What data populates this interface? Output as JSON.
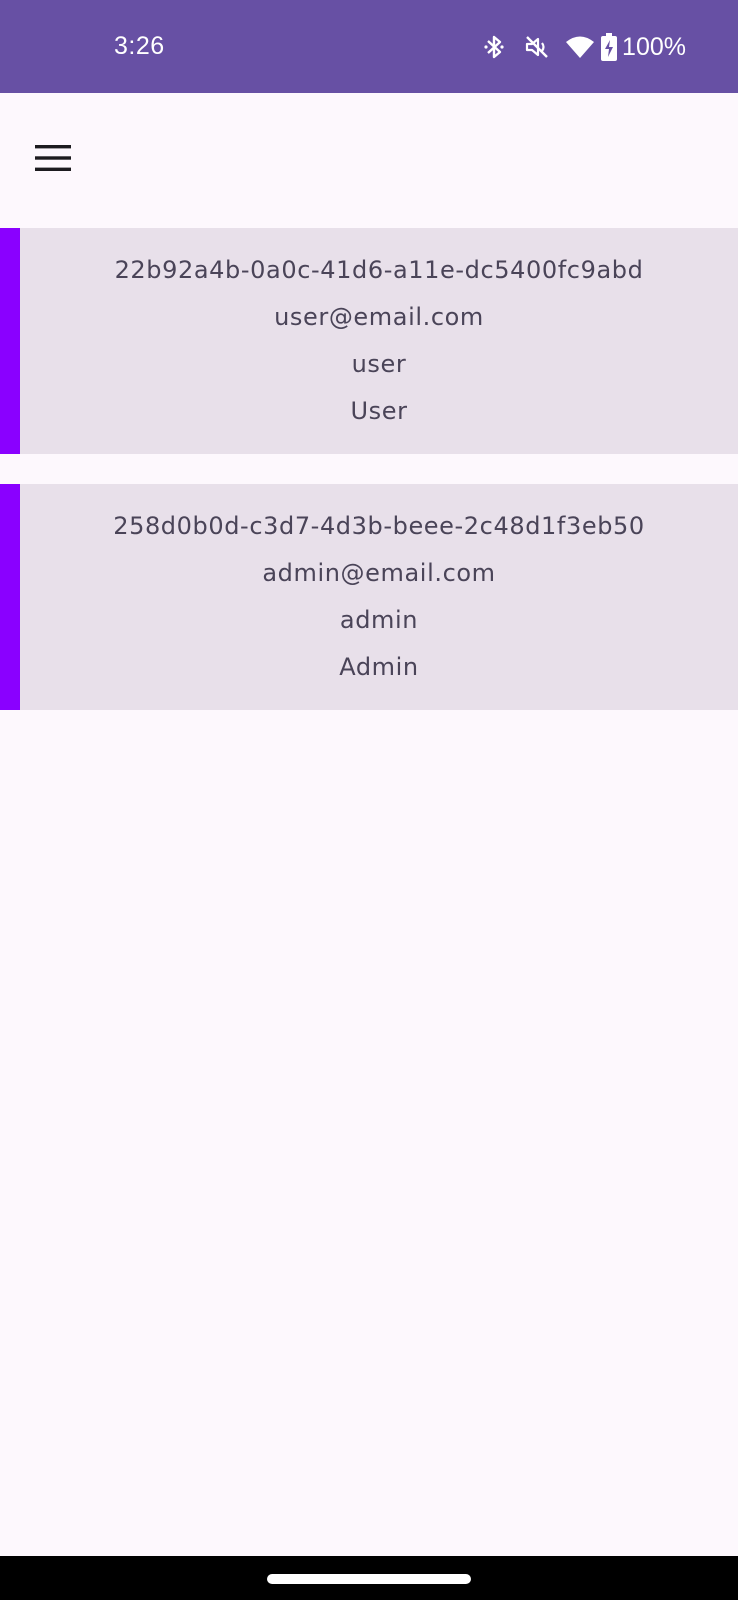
{
  "status_bar": {
    "time": "3:26",
    "battery": "100%",
    "icons": [
      "bluetooth-icon",
      "mute-vibrate-off-icon",
      "wifi-icon",
      "battery-charging-icon"
    ],
    "background": "#6750a4"
  },
  "app_bar": {
    "menu_icon": "hamburger-menu-icon"
  },
  "users": [
    {
      "id": "22b92a4b-0a0c-41d6-a11e-dc5400fc9abd",
      "email": "user@email.com",
      "username": "user",
      "role": "User"
    },
    {
      "id": "258d0b0d-c3d7-4d3b-beee-2c48d1f3eb50",
      "email": "admin@email.com",
      "username": "admin",
      "role": "Admin"
    }
  ],
  "colors": {
    "accent": "#8a00ff",
    "card_background": "#e8e0ea",
    "page_background": "#fdf8fd",
    "text": "#4a4458"
  }
}
